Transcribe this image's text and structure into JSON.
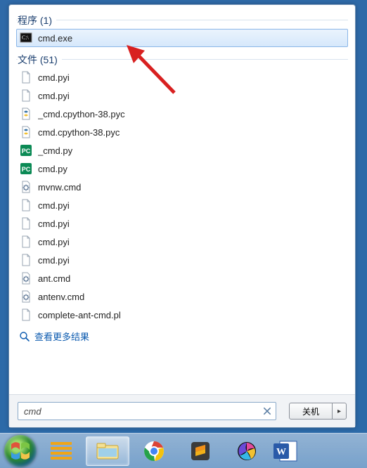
{
  "sections": {
    "programs": {
      "title": "程序 (1)"
    },
    "files": {
      "title": "文件 (51)"
    }
  },
  "programsList": [
    {
      "name": "cmd.exe",
      "icon": "cmd-exe"
    }
  ],
  "filesList": [
    {
      "name": "cmd.pyi",
      "icon": "file"
    },
    {
      "name": "cmd.pyi",
      "icon": "file"
    },
    {
      "name": "_cmd.cpython-38.pyc",
      "icon": "pyc"
    },
    {
      "name": "cmd.cpython-38.pyc",
      "icon": "pyc"
    },
    {
      "name": "_cmd.py",
      "icon": "pc"
    },
    {
      "name": "cmd.py",
      "icon": "pc"
    },
    {
      "name": "mvnw.cmd",
      "icon": "gear"
    },
    {
      "name": "cmd.pyi",
      "icon": "file"
    },
    {
      "name": "cmd.pyi",
      "icon": "file"
    },
    {
      "name": "cmd.pyi",
      "icon": "file"
    },
    {
      "name": "cmd.pyi",
      "icon": "file"
    },
    {
      "name": "ant.cmd",
      "icon": "gear"
    },
    {
      "name": "antenv.cmd",
      "icon": "gear"
    },
    {
      "name": "complete-ant-cmd.pl",
      "icon": "file"
    }
  ],
  "moreResults": "查看更多结果",
  "search": {
    "value": "cmd"
  },
  "shutdown": {
    "label": "关机"
  }
}
